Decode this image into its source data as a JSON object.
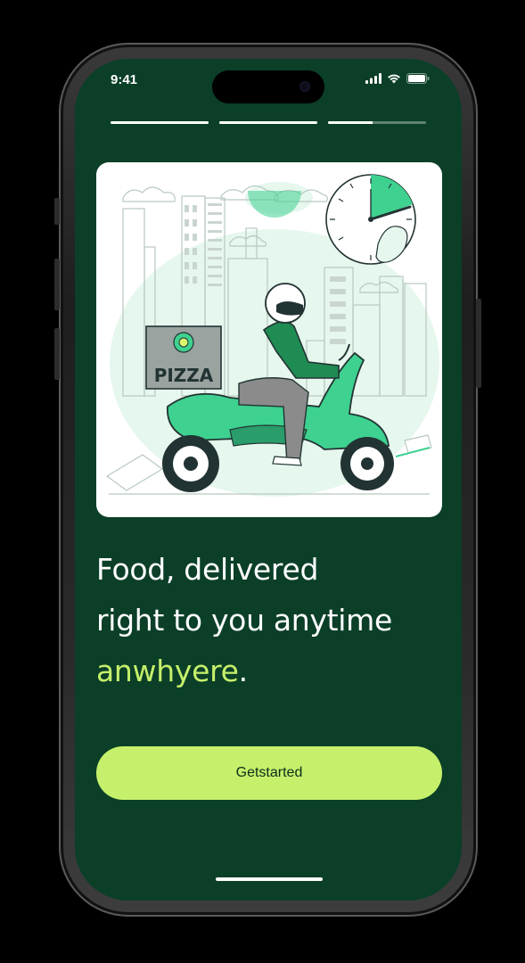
{
  "status_bar": {
    "time": "9:41",
    "icons": [
      "cellular-signal-icon",
      "wifi-icon",
      "battery-icon"
    ]
  },
  "onboarding": {
    "progress_steps": [
      1,
      1,
      0.45
    ],
    "illustration": {
      "description": "delivery-scooter-illustration",
      "box_label": "PIZZA"
    },
    "headline": {
      "line1": "Food, delivered",
      "line2": "right to you anytime",
      "accent_word": "anwhyere",
      "period": "."
    },
    "cta_label": "Getstarted"
  },
  "colors": {
    "background": "#0b3f28",
    "accent": "#c6f06b",
    "illustration_green": "#3ed18f"
  }
}
